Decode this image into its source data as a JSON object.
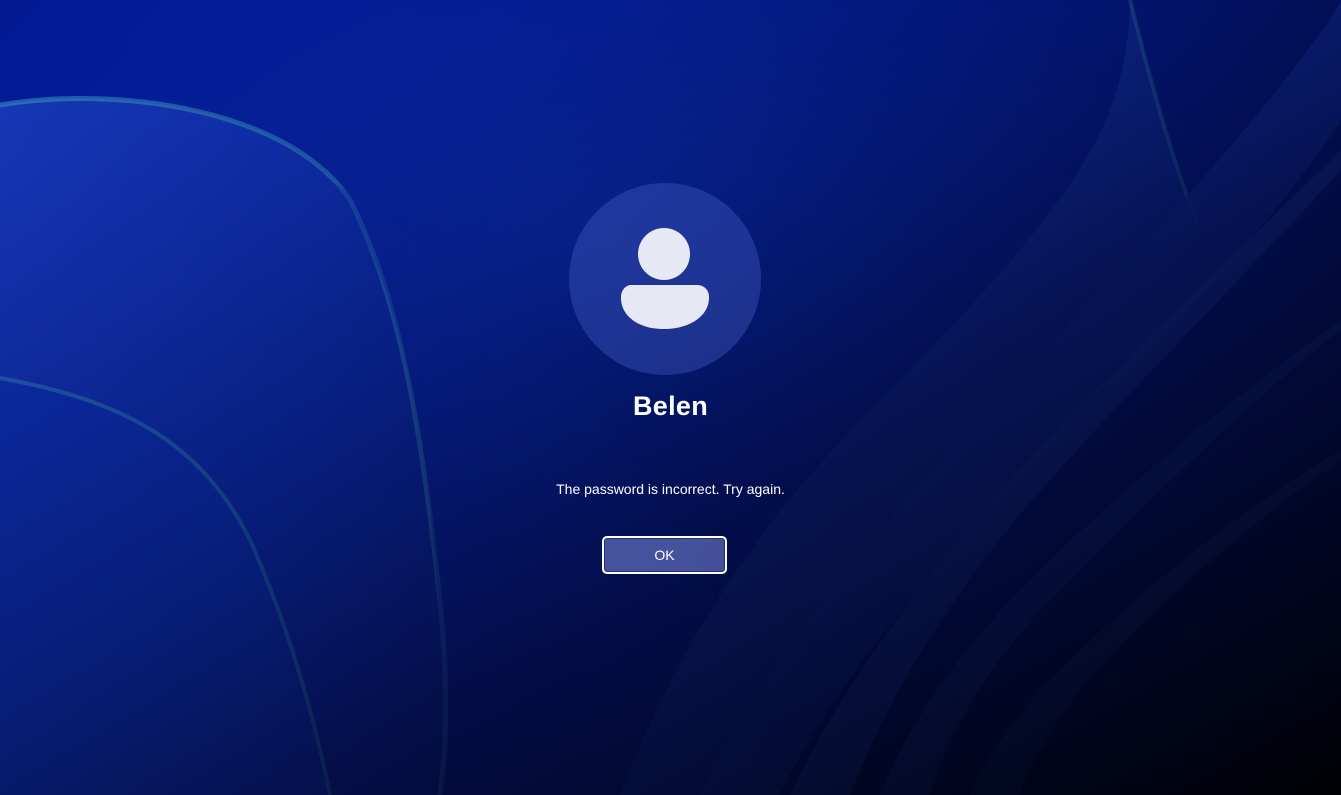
{
  "login": {
    "username": "Belen",
    "error_message": "The password is incorrect. Try again.",
    "ok_label": "OK"
  },
  "icons": {
    "avatar": "user-silhouette-icon"
  },
  "colors": {
    "background": "#00167a",
    "text": "#ffffff",
    "avatar_glyph": "#e6e8f4"
  }
}
